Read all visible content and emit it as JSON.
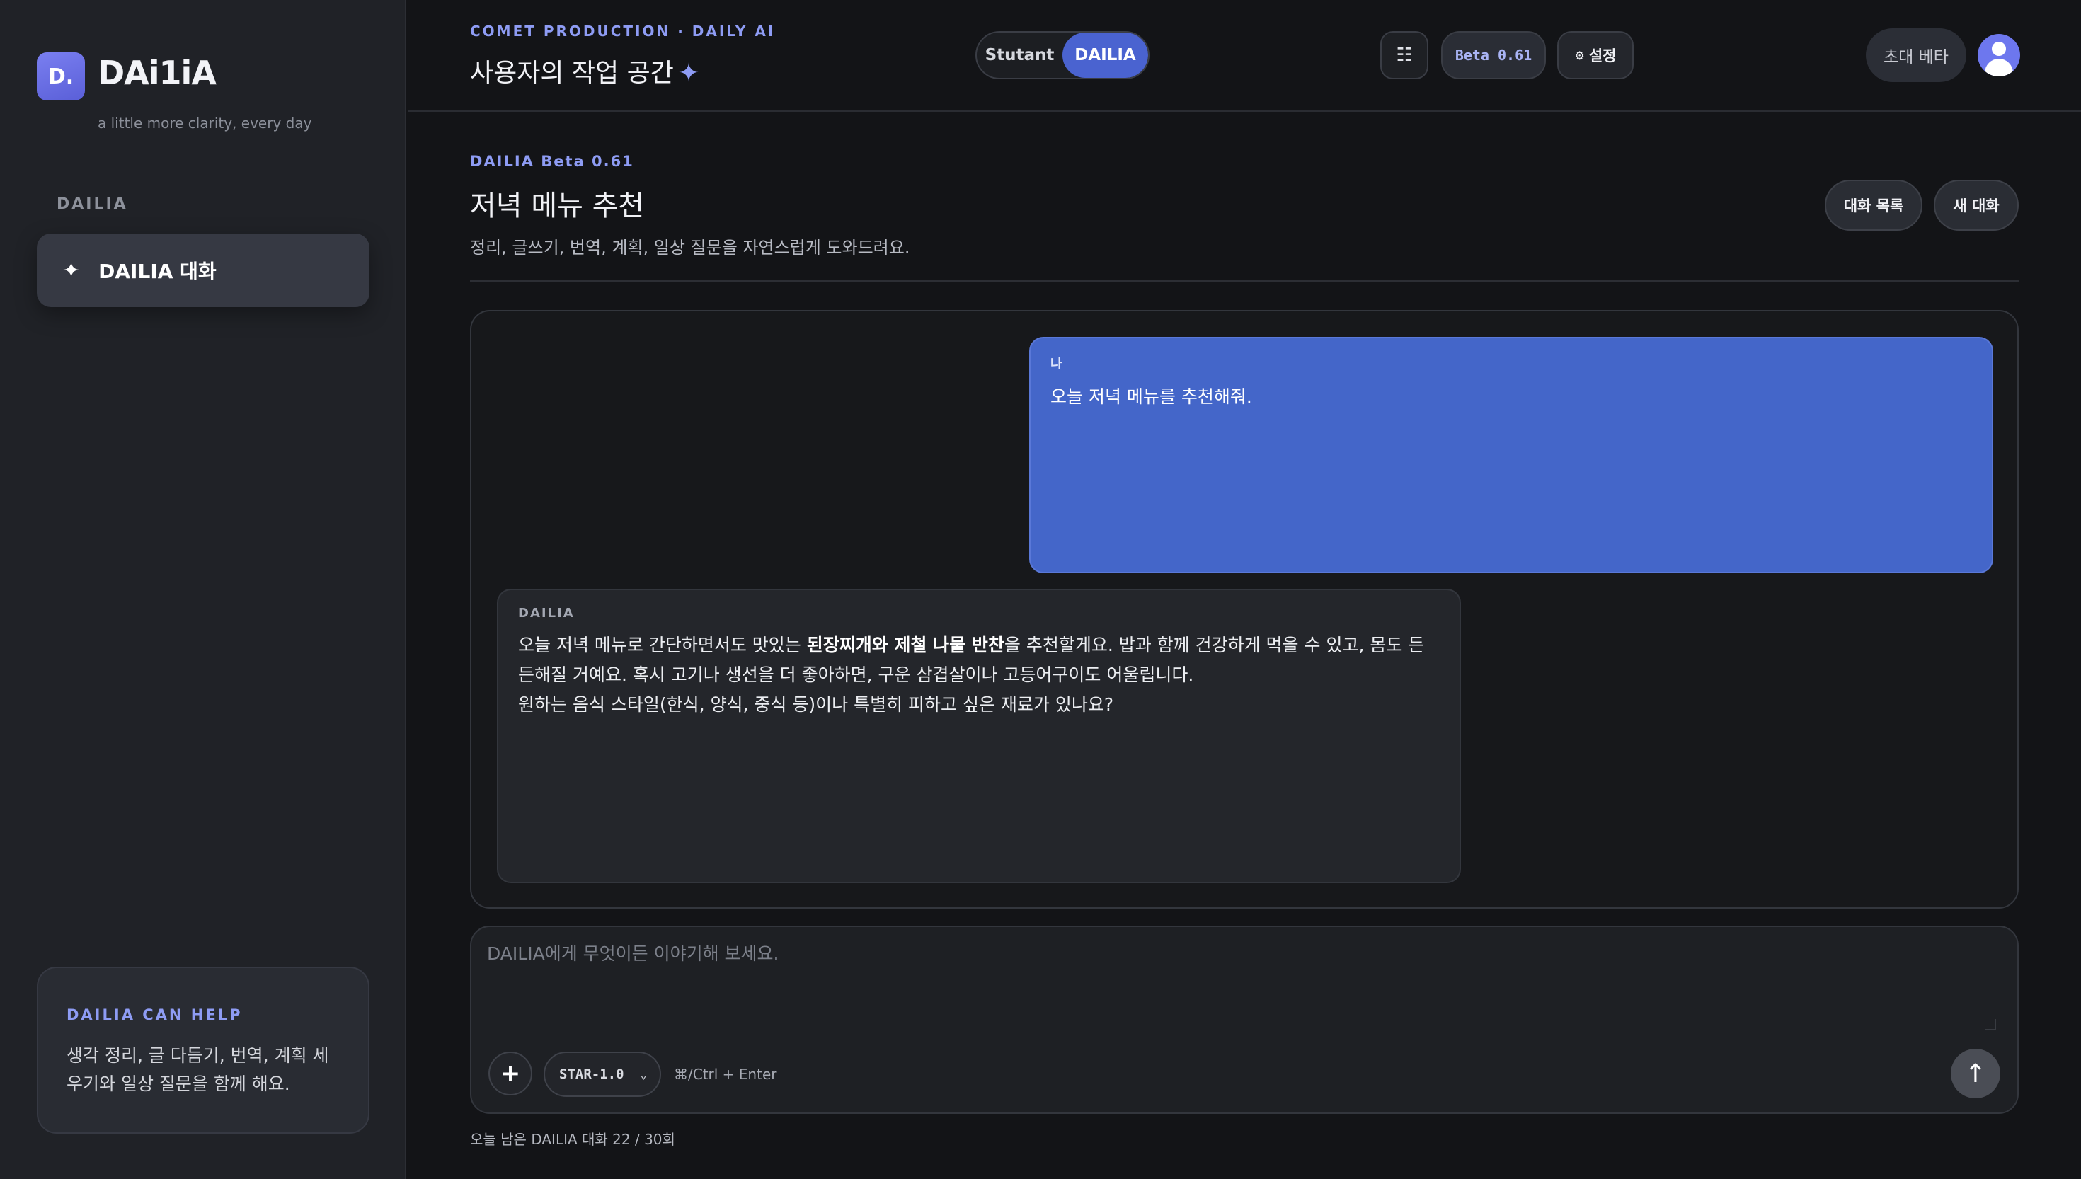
{
  "sidebar": {
    "logo_badge": "D.",
    "logo_text": "DAi1iA",
    "tagline": "a little more clarity, every day",
    "section_label": "DAILIA",
    "nav_items": [
      {
        "icon": "sparkle-icon",
        "glyph": "✦",
        "label": "DAILIA 대화"
      }
    ],
    "help": {
      "title": "DAILIA CAN HELP",
      "text": "생각 정리, 글 다듬기, 번역, 계획 세우기와 일상 질문을 함께 해요."
    }
  },
  "header": {
    "eyebrow": "COMET PRODUCTION · DAILY AI",
    "title": "사용자의 작업 공간",
    "title_icon": "✦",
    "modes": [
      "Stutant",
      "DAILIA"
    ],
    "active_mode": "DAILIA",
    "grid_icon": "☷",
    "beta_label": "Beta 0.61",
    "settings_icon": "⚙",
    "settings_label": "설정",
    "invite_label": "초대 베타"
  },
  "main": {
    "eyebrow": "DAILIA Beta 0.61",
    "title": "저녁 메뉴 추천",
    "description": "정리, 글쓰기, 번역, 계획, 일상 질문을 자연스럽게 도와드려요.",
    "actions": {
      "history_label": "대화 목록",
      "new_chat_label": "새 대화"
    },
    "messages": [
      {
        "role": "user",
        "who": "나",
        "text": "오늘 저녁 메뉴를 추천해줘."
      },
      {
        "role": "assistant",
        "who": "DAILIA",
        "text_before": "오늘 저녁 메뉴로 간단하면서도 맛있는 ",
        "text_bold": "된장찌개와 제철 나물 반찬",
        "text_after": "을 추천할게요. 밥과 함께 건강하게 먹을 수 있고, 몸도 든든해질 거예요. 혹시 고기나 생선을 더 좋아하면, 구운 삼겹살이나 고등어구이도 어울립니다.",
        "text_line2": "원하는 음식 스타일(한식, 양식, 중식 등)이나 특별히 피하고 싶은 재료가 있나요?"
      }
    ],
    "composer": {
      "placeholder": "DAILIA에게 무엇이든 이야기해 보세요.",
      "value": "",
      "plus_glyph": "+",
      "model": "STAR-1.0",
      "chevron": "⌄",
      "shortcut": "⌘/Ctrl + Enter",
      "send_glyph": "↑"
    },
    "quota_text": "오늘 남은 DAILIA 대화 22 / 30회"
  },
  "colors": {
    "accent": "#4a63d0",
    "accent_text": "#8e9cf4",
    "user_bubble": "#4466c9",
    "background": "#131417",
    "sidebar": "#202227"
  }
}
